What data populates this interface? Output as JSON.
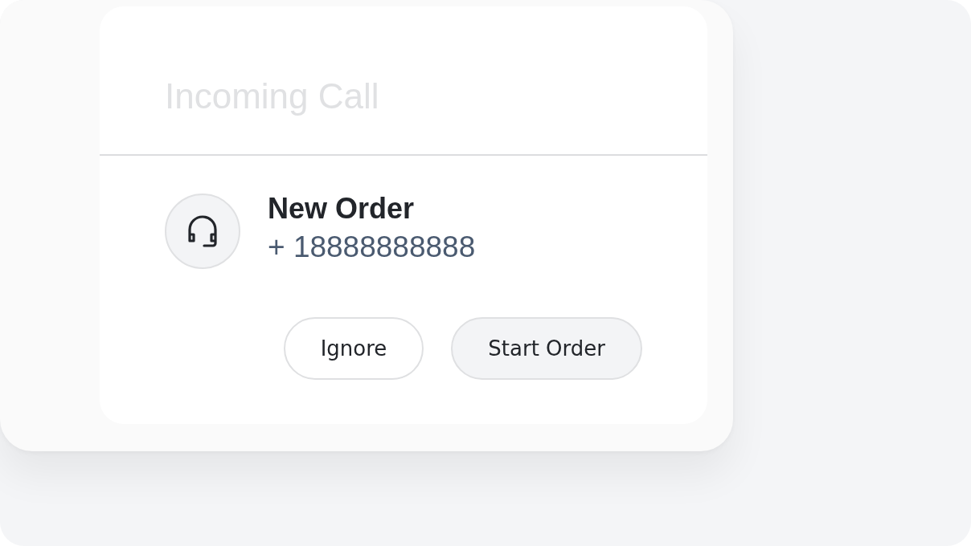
{
  "dialog": {
    "title": "Incoming Call"
  },
  "caller": {
    "name": "New Order",
    "phone": "+ 18888888888"
  },
  "buttons": [
    {
      "label": "Ignore",
      "kind": "secondary"
    },
    {
      "label": "Start Order",
      "kind": "primary"
    }
  ]
}
